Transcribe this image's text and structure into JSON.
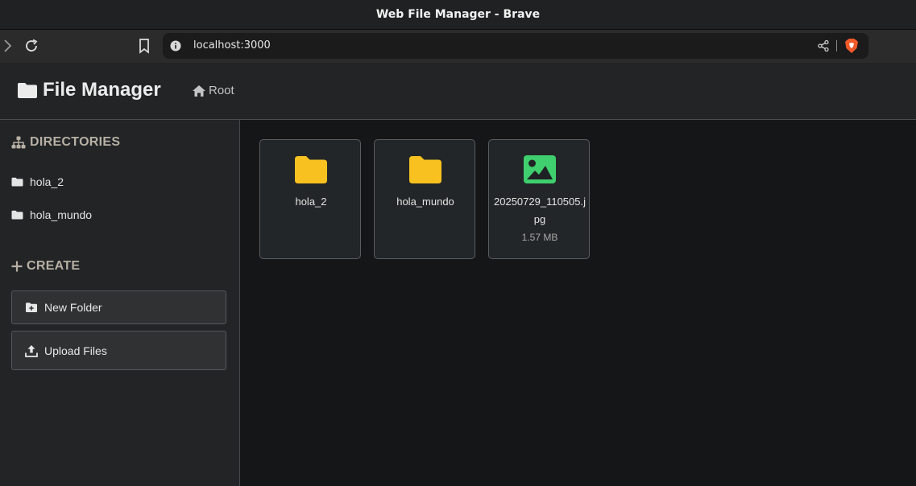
{
  "window": {
    "title": "Web File Manager - Brave"
  },
  "browser": {
    "url": "localhost:3000"
  },
  "header": {
    "title": "File Manager",
    "root_label": "Root"
  },
  "sidebar": {
    "directories_title": "DIRECTORIES",
    "directories": [
      {
        "label": "hola_2",
        "icon": "folder-icon"
      },
      {
        "label": "hola_mundo",
        "icon": "folder-icon"
      }
    ],
    "create_title": "CREATE",
    "new_folder_label": "New Folder",
    "upload_files_label": "Upload Files"
  },
  "main": {
    "items": [
      {
        "name": "hola_2",
        "type": "folder",
        "icon": "folder-icon",
        "size": ""
      },
      {
        "name": "hola_mundo",
        "type": "folder",
        "icon": "folder-icon",
        "size": ""
      },
      {
        "name": "20250729_110505.jpg",
        "type": "image",
        "icon": "image-icon",
        "size": "1.57 MB"
      }
    ]
  },
  "colors": {
    "folder": "#f9c11f",
    "image": "#3fcf6e",
    "background": "#151617",
    "panel": "#222426",
    "section_heading": "#b7b0a4"
  }
}
